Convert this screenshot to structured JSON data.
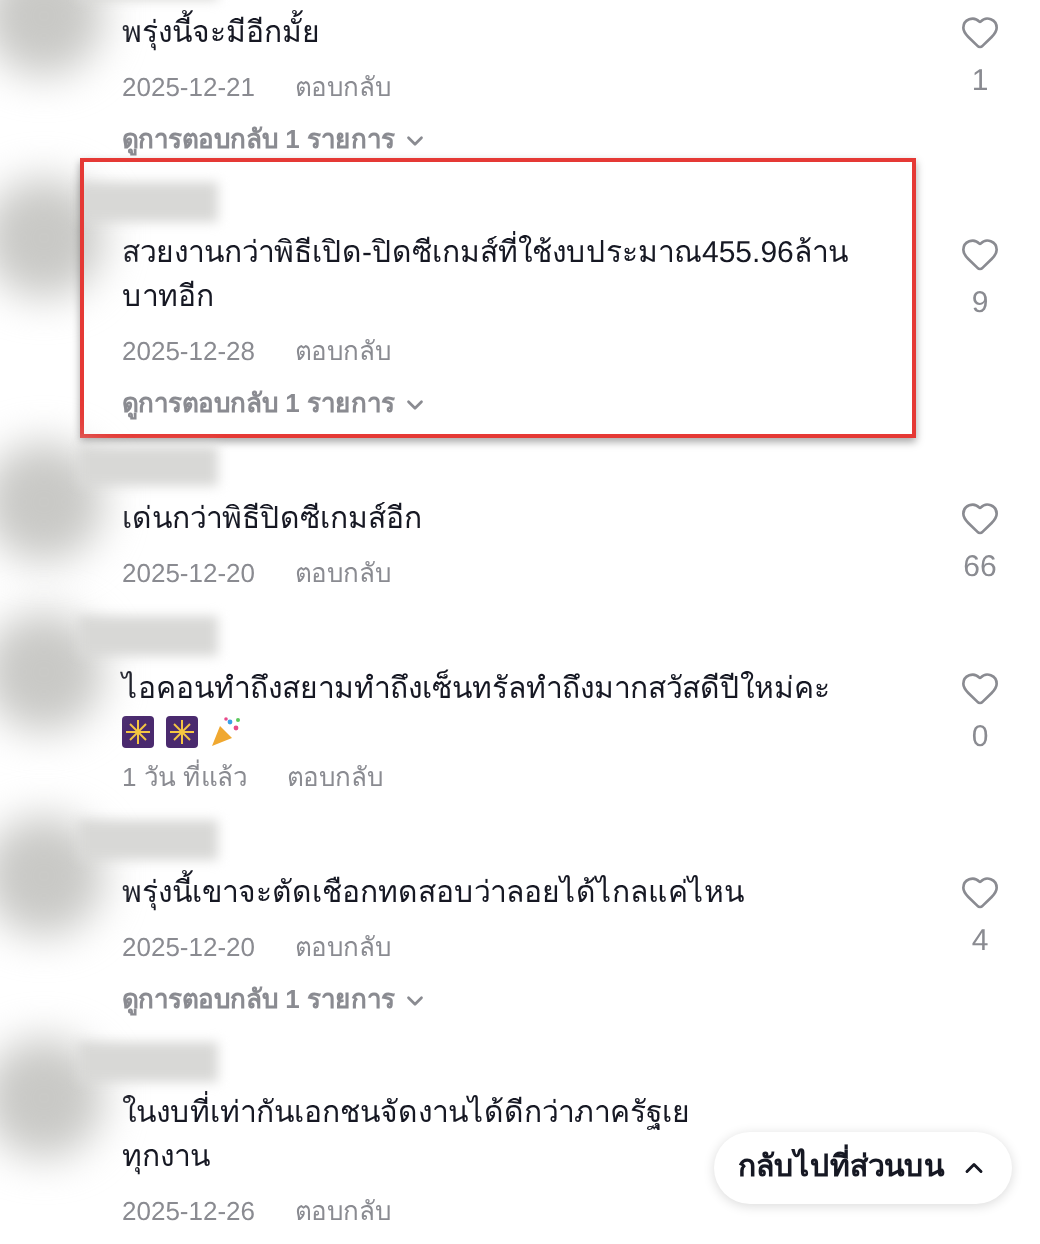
{
  "comments": [
    {
      "text": "พรุ่งนี้จะมีอีกมั้ย",
      "date": "2025-12-21",
      "reply": "ตอบกลับ",
      "likes": "1",
      "view_replies": "ดูการตอบกลับ 1 รายการ",
      "highlighted": false
    },
    {
      "text": "สวยงานกว่าพิธีเปิด-ปิดซีเกมส์ที่ใช้งบประมาณ455.96ล้าน\nบาทอีก",
      "date": "2025-12-28",
      "reply": "ตอบกลับ",
      "likes": "9",
      "view_replies": "ดูการตอบกลับ 1 รายการ",
      "highlighted": true
    },
    {
      "text": "เด่นกว่าพิธีปิดซีเกมส์อีก",
      "date": "2025-12-20",
      "reply": "ตอบกลับ",
      "likes": "66",
      "highlighted": false
    },
    {
      "text": "ไอคอนทำถึงสยามทำถึงเซ็นทรัลทำถึงมากสวัสดีปีใหม่คะ",
      "emoji_icons": [
        {
          "kind": "fireworks"
        },
        {
          "kind": "fireworks"
        },
        {
          "kind": "party-popper"
        }
      ],
      "date": "1 วัน ที่แล้ว",
      "reply": "ตอบกลับ",
      "likes": "0",
      "highlighted": false
    },
    {
      "text": "พรุ่งนี้เขาจะตัดเชือกทดสอบว่าลอยได้ไกลแค่ไหน",
      "date": "2025-12-20",
      "reply": "ตอบกลับ",
      "likes": "4",
      "view_replies": "ดูการตอบกลับ 1 รายการ",
      "highlighted": false
    },
    {
      "text": "ในงบที่เท่ากันเอกชนจัดงานได้ดีกว่าภาครัฐเย\nทุกงาน",
      "date": "2025-12-26",
      "reply": "ตอบกลับ",
      "highlighted": false
    }
  ],
  "back_to_top": {
    "label": "กลับไปที่ส่วนบน"
  }
}
